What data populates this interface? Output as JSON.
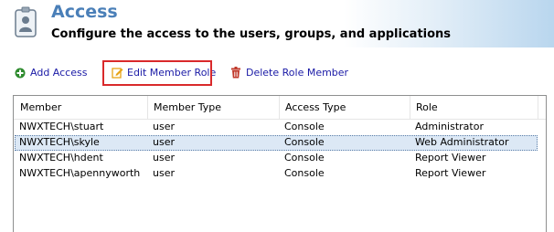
{
  "header": {
    "title": "Access",
    "subtitle": "Configure the access to the users, groups, and applications",
    "icon": "user-badge-icon"
  },
  "toolbar": {
    "add_access": {
      "label": "Add Access",
      "icon": "plus-circle-icon",
      "color": "#2e8b2e"
    },
    "edit_member_role": {
      "label": "Edit Member Role",
      "icon": "pencil-edit-icon",
      "color": "#e8a317",
      "highlighted": true
    },
    "delete_role_member": {
      "label": "Delete Role Member",
      "icon": "trash-icon",
      "color": "#c0392b"
    }
  },
  "table": {
    "columns": [
      "Member",
      "Member Type",
      "Access Type",
      "Role"
    ],
    "rows": [
      {
        "member": "NWXTECH\\stuart",
        "member_type": "user",
        "access_type": "Console",
        "role": "Administrator",
        "selected": false
      },
      {
        "member": "NWXTECH\\skyle",
        "member_type": "user",
        "access_type": "Console",
        "role": "Web Administrator",
        "selected": true
      },
      {
        "member": "NWXTECH\\hdent",
        "member_type": "user",
        "access_type": "Console",
        "role": "Report Viewer",
        "selected": false
      },
      {
        "member": "NWXTECH\\apennyworth",
        "member_type": "user",
        "access_type": "Console",
        "role": "Report Viewer",
        "selected": false
      }
    ]
  },
  "colors": {
    "title": "#4a7fb8",
    "link": "#1a1aa6",
    "highlight_border": "#d9292b",
    "selected_row": "#dce8f5"
  }
}
